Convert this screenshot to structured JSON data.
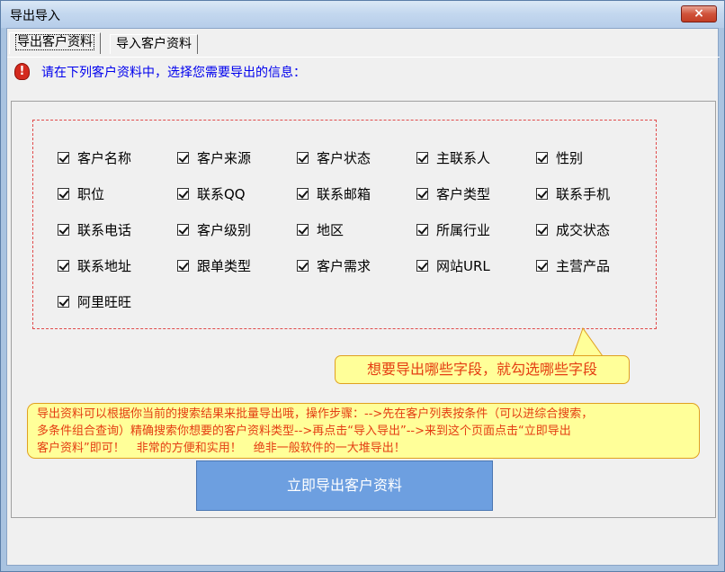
{
  "window": {
    "title": "导出导入",
    "close_label": "×"
  },
  "tabs": [
    {
      "label": "导出客户资料",
      "active": true
    },
    {
      "label": "导入客户资料",
      "active": false
    }
  ],
  "instruction": "请在下列客户资料中，选择您需要导出的信息：",
  "fields": [
    {
      "label": "客户名称",
      "checked": true
    },
    {
      "label": "客户来源",
      "checked": true
    },
    {
      "label": "客户状态",
      "checked": true
    },
    {
      "label": "主联系人",
      "checked": true
    },
    {
      "label": "性别",
      "checked": true
    },
    {
      "label": "职位",
      "checked": true
    },
    {
      "label": "联系QQ",
      "checked": true
    },
    {
      "label": "联系邮箱",
      "checked": true
    },
    {
      "label": "客户类型",
      "checked": true
    },
    {
      "label": "联系手机",
      "checked": true
    },
    {
      "label": "联系电话",
      "checked": true
    },
    {
      "label": "客户级别",
      "checked": true
    },
    {
      "label": "地区",
      "checked": true
    },
    {
      "label": "所属行业",
      "checked": true
    },
    {
      "label": "成交状态",
      "checked": true
    },
    {
      "label": "联系地址",
      "checked": true
    },
    {
      "label": "跟单类型",
      "checked": true
    },
    {
      "label": "客户需求",
      "checked": true
    },
    {
      "label": "网站URL",
      "checked": true
    },
    {
      "label": "主营产品",
      "checked": true
    },
    {
      "label": "阿里旺旺",
      "checked": true
    }
  ],
  "callout": "想要导出哪些字段，就勾选哪些字段",
  "note": {
    "line1": "导出资料可以根据你当前的搜索结果来批量导出哦，操作步骤：-->先在客户列表按条件（可以进综合搜索，",
    "line2": "多条件组合查询）精确搜索你想要的客户资料类型-->再点击“导入导出”-->来到这个页面点击“立即导出",
    "line3": "客户资料”即可！　非常的方便和实用！　绝非一般软件的一大堆导出！"
  },
  "export_button": "立即导出客户资料",
  "colors": {
    "accent": "#6d9fe0",
    "warning_text": "#e43d12",
    "note_bg": "#ffff99",
    "instruction": "#0000ee"
  }
}
